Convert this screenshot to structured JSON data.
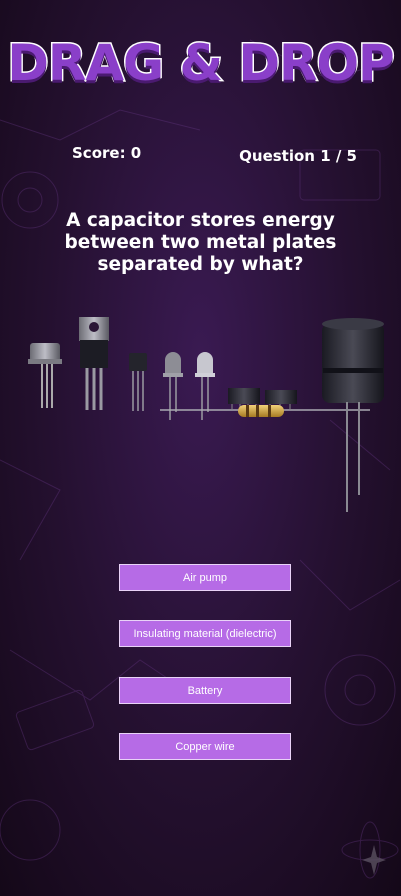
{
  "game": {
    "title": "DRAG & DROP",
    "score_text": "Score: 0",
    "question_counter": "Question 1 / 5",
    "question": "A capacitor stores energy between two metal plates separated by what?"
  },
  "answers": [
    {
      "label": "Air pump"
    },
    {
      "label": "Insulating material (dielectric)"
    },
    {
      "label": "Battery"
    },
    {
      "label": "Copper wire"
    }
  ],
  "components": [
    "transistor-metal-can",
    "voltage-regulator",
    "small-transistor",
    "led-grey",
    "led-white",
    "chip",
    "chip",
    "resistor",
    "electrolytic-capacitor"
  ],
  "colors": {
    "accent": "#b66be6",
    "title": "#8a3fc9",
    "background": "#24102f"
  }
}
